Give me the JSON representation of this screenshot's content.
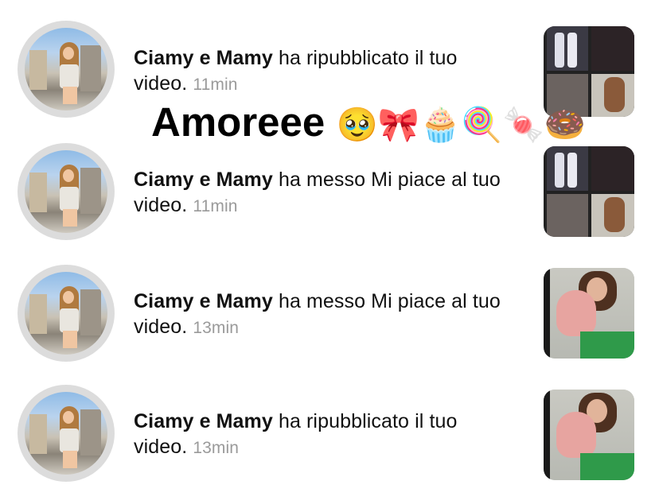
{
  "caption": {
    "text": "Amoreee",
    "emojis": "🥹🎀🧁🍭🍬🍩"
  },
  "notifications": [
    {
      "user": "Ciamy e Mamy",
      "action": " ha ripubblicato il tuo video. ",
      "time": "11min",
      "thumb": "collage"
    },
    {
      "user": "Ciamy e Mamy",
      "action": " ha messo Mi piace al tuo video. ",
      "time": "11min",
      "thumb": "collage"
    },
    {
      "user": "Ciamy e Mamy",
      "action": " ha messo Mi piace al tuo video. ",
      "time": "13min",
      "thumb": "hand"
    },
    {
      "user": "Ciamy e Mamy",
      "action": " ha ripubblicato il tuo video. ",
      "time": "13min",
      "thumb": "hand"
    }
  ]
}
